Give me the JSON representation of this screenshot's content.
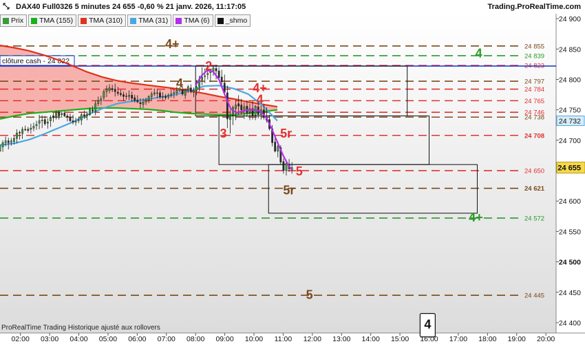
{
  "header": {
    "instrument": "DAX40 Full0326 5 minutes 24 655 -0,60 % 21 janv. 2026, 11:17:05",
    "site": "Trading.ProRealTime.com"
  },
  "legend": [
    {
      "label": "Prix",
      "color": "#3a9b3a"
    },
    {
      "label": "TMA (155)",
      "color": "#1ab21a"
    },
    {
      "label": "TMA (310)",
      "color": "#e0321a"
    },
    {
      "label": "TMA (31)",
      "color": "#4aa8e0"
    },
    {
      "label": "TMA (6)",
      "color": "#b030e8"
    },
    {
      "label": "_shmo",
      "color": "#111111"
    }
  ],
  "footer_note": "ProRealTime Trading  Historique ajusté aux rollovers",
  "chart_data": {
    "type": "candlestick",
    "x_ticks": [
      "02:00",
      "03:00",
      "04:00",
      "05:00",
      "06:00",
      "07:00",
      "08:00",
      "09:00",
      "10:00",
      "11:00",
      "12:00",
      "13:00",
      "14:00",
      "15:00",
      "16:00",
      "17:00",
      "18:00",
      "19:00",
      "20:00"
    ],
    "y_ticks": [
      24400,
      24450,
      24500,
      24550,
      24600,
      24650,
      24700,
      24750,
      24800,
      24850,
      24900
    ],
    "y_bold_tick": 24500,
    "ylim": [
      24383,
      24908
    ],
    "current_price": {
      "value": 24655,
      "label": "24 655"
    },
    "ma_31_value": {
      "value": 24732,
      "label": "24 732"
    },
    "cash_close": {
      "label": "clôture cash - 24 822",
      "value": 24822,
      "color": "#1030c8"
    },
    "levels": [
      {
        "value": 24855,
        "label": "24 855",
        "color": "#7a4a1a",
        "bold": false
      },
      {
        "value": 24839,
        "label": "24 839",
        "color": "#2a9a2a",
        "bold": false
      },
      {
        "value": 24823,
        "label": "24 823",
        "color": "#e23030",
        "bold": false
      },
      {
        "value": 24797,
        "label": "24 797",
        "color": "#7a4a1a",
        "bold": false
      },
      {
        "value": 24784,
        "label": "24 784",
        "color": "#e23030",
        "bold": false
      },
      {
        "value": 24765,
        "label": "24 765",
        "color": "#e23030",
        "bold": false
      },
      {
        "value": 24746,
        "label": "24 746",
        "color": "#e23030",
        "bold": false
      },
      {
        "value": 24738,
        "label": "24 738",
        "color": "#7a4a1a",
        "bold": false
      },
      {
        "value": 24708,
        "label": "24 708",
        "color": "#e23030",
        "bold": true
      },
      {
        "value": 24650,
        "label": "24 650",
        "color": "#e23030",
        "bold": false
      },
      {
        "value": 24621,
        "label": "24 621",
        "color": "#7a4a1a",
        "bold": true
      },
      {
        "value": 24572,
        "label": "24 572",
        "color": "#2a9a2a",
        "bold": false
      },
      {
        "value": 24445,
        "label": "24 445",
        "color": "#7a4a1a",
        "bold": false
      }
    ],
    "annotations": [
      {
        "text": "4+",
        "t": 7.2,
        "v": 24858,
        "color": "#7a4a1a"
      },
      {
        "text": "4",
        "t": 17.7,
        "v": 24843,
        "color": "#2a9a2a"
      },
      {
        "text": "2",
        "t": 8.45,
        "v": 24822,
        "color": "#e23030"
      },
      {
        "text": "4",
        "t": 7.45,
        "v": 24794,
        "color": "#7a4a1a"
      },
      {
        "text": "4+",
        "t": 10.2,
        "v": 24786,
        "color": "#e23030"
      },
      {
        "text": "4",
        "t": 10.2,
        "v": 24767,
        "color": "#e23030"
      },
      {
        "text": "3",
        "t": 8.95,
        "v": 24711,
        "color": "#e23030"
      },
      {
        "text": "5r",
        "t": 11.1,
        "v": 24711,
        "color": "#e23030"
      },
      {
        "text": "5",
        "t": 11.55,
        "v": 24649,
        "color": "#e23030"
      },
      {
        "text": "5r",
        "t": 11.2,
        "v": 24618,
        "color": "#7a4a1a"
      },
      {
        "text": "4+",
        "t": 17.6,
        "v": 24573,
        "color": "#2a9a2a"
      },
      {
        "text": "5",
        "t": 11.9,
        "v": 24446,
        "color": "#7a4a1a"
      },
      {
        "text": "4",
        "t": 15.95,
        "v": 24397,
        "color": "#111111",
        "boxed": true
      }
    ],
    "boxes": [
      {
        "t0": 8.0,
        "t1": 15.25,
        "v0": 24822,
        "v1": 24740
      },
      {
        "t0": 8.8,
        "t1": 16.0,
        "v0": 24740,
        "v1": 24660
      },
      {
        "t0": 10.5,
        "t1": 17.65,
        "v0": 24660,
        "v1": 24580
      }
    ],
    "time_range": [
      1.3,
      20.35
    ],
    "candles_ohlc": [
      [
        24682,
        24693,
        24681,
        24690
      ],
      [
        24689,
        24700,
        24681,
        24696
      ],
      [
        24696,
        24706,
        24690,
        24699
      ],
      [
        24699,
        24704,
        24685,
        24696
      ],
      [
        24697,
        24704,
        24691,
        24699
      ],
      [
        24698,
        24707,
        24693,
        24703
      ],
      [
        24703,
        24718,
        24695,
        24712
      ],
      [
        24713,
        24716,
        24701,
        24712
      ],
      [
        24711,
        24722,
        24702,
        24718
      ],
      [
        24718,
        24724,
        24715,
        24717
      ],
      [
        24718,
        24722,
        24712,
        24716
      ],
      [
        24718,
        24727,
        24711,
        24720
      ],
      [
        24720,
        24729,
        24715,
        24723
      ],
      [
        24724,
        24732,
        24717,
        24726
      ],
      [
        24728,
        24742,
        24718,
        24732
      ],
      [
        24733,
        24741,
        24720,
        24733
      ],
      [
        24734,
        24740,
        24724,
        24727
      ],
      [
        24728,
        24736,
        24719,
        24730
      ],
      [
        24732,
        24741,
        24722,
        24738
      ],
      [
        24740,
        24745,
        24730,
        24737
      ],
      [
        24738,
        24749,
        24734,
        24746
      ],
      [
        24746,
        24749,
        24734,
        24740
      ],
      [
        24742,
        24747,
        24737,
        24744
      ],
      [
        24745,
        24748,
        24738,
        24740
      ],
      [
        24740,
        24744,
        24731,
        24739
      ],
      [
        24738,
        24744,
        24730,
        24732
      ],
      [
        24732,
        24742,
        24726,
        24730
      ],
      [
        24730,
        24737,
        24724,
        24731
      ],
      [
        24732,
        24738,
        24728,
        24734
      ],
      [
        24733,
        24746,
        24725,
        24742
      ],
      [
        24742,
        24749,
        24735,
        24740
      ],
      [
        24740,
        24747,
        24733,
        24743
      ],
      [
        24742,
        24754,
        24740,
        24750
      ],
      [
        24750,
        24756,
        24745,
        24748
      ],
      [
        24748,
        24765,
        24741,
        24760
      ],
      [
        24760,
        24772,
        24756,
        24765
      ],
      [
        24765,
        24773,
        24758,
        24768
      ],
      [
        24770,
        24784,
        24764,
        24780
      ],
      [
        24780,
        24790,
        24771,
        24784
      ],
      [
        24782,
        24792,
        24777,
        24786
      ],
      [
        24785,
        24791,
        24779,
        24783
      ],
      [
        24784,
        24793,
        24772,
        24780
      ],
      [
        24779,
        24788,
        24773,
        24777
      ],
      [
        24777,
        24783,
        24772,
        24775
      ],
      [
        24775,
        24780,
        24765,
        24772
      ],
      [
        24772,
        24778,
        24767,
        24773
      ],
      [
        24772,
        24782,
        24766,
        24774
      ],
      [
        24774,
        24780,
        24763,
        24769
      ],
      [
        24770,
        24775,
        24762,
        24765
      ],
      [
        24766,
        24774,
        24761,
        24763
      ],
      [
        24762,
        24769,
        24752,
        24760
      ],
      [
        24759,
        24769,
        24753,
        24763
      ],
      [
        24763,
        24770,
        24758,
        24766
      ],
      [
        24766,
        24774,
        24761,
        24772
      ],
      [
        24772,
        24780,
        24766,
        24776
      ],
      [
        24776,
        24785,
        24773,
        24778
      ],
      [
        24778,
        24784,
        24769,
        24778
      ],
      [
        24778,
        24782,
        24768,
        24771
      ],
      [
        24772,
        24779,
        24766,
        24772
      ],
      [
        24772,
        24776,
        24766,
        24770
      ],
      [
        24771,
        24777,
        24767,
        24774
      ],
      [
        24774,
        24782,
        24770,
        24776
      ],
      [
        24777,
        24784,
        24769,
        24778
      ],
      [
        24778,
        24788,
        24773,
        24782
      ],
      [
        24782,
        24787,
        24779,
        24785
      ],
      [
        24783,
        24789,
        24773,
        24776
      ],
      [
        24774,
        24784,
        24768,
        24782
      ],
      [
        24783,
        24791,
        24778,
        24788
      ],
      [
        24786,
        24792,
        24777,
        24780
      ],
      [
        24779,
        24787,
        24771,
        24782
      ],
      [
        24782,
        24799,
        24774,
        24788
      ],
      [
        24788,
        24806,
        24780,
        24800
      ],
      [
        24799,
        24820,
        24790,
        24804
      ],
      [
        24806,
        24818,
        24794,
        24806
      ],
      [
        24808,
        24824,
        24800,
        24810
      ],
      [
        24811,
        24817,
        24796,
        24814
      ],
      [
        24812,
        24822,
        24806,
        24819
      ],
      [
        24818,
        24824,
        24800,
        24814
      ],
      [
        24814,
        24820,
        24799,
        24803
      ],
      [
        24804,
        24816,
        24786,
        24796
      ],
      [
        24794,
        24808,
        24774,
        24779
      ],
      [
        24778,
        24790,
        24720,
        24735
      ],
      [
        24734,
        24750,
        24711,
        24740
      ],
      [
        24741,
        24757,
        24725,
        24754
      ],
      [
        24752,
        24766,
        24733,
        24758
      ],
      [
        24760,
        24774,
        24742,
        24756
      ],
      [
        24758,
        24768,
        24742,
        24750
      ],
      [
        24748,
        24762,
        24735,
        24755
      ],
      [
        24756,
        24766,
        24738,
        24745
      ],
      [
        24746,
        24760,
        24733,
        24752
      ],
      [
        24752,
        24764,
        24734,
        24740
      ],
      [
        24741,
        24758,
        24733,
        24756
      ],
      [
        24755,
        24764,
        24736,
        24742
      ],
      [
        24742,
        24757,
        24734,
        24750
      ],
      [
        24750,
        24759,
        24734,
        24738
      ],
      [
        24737,
        24754,
        24729,
        24733
      ],
      [
        24734,
        24742,
        24716,
        24719
      ],
      [
        24719,
        24725,
        24690,
        24696
      ],
      [
        24697,
        24708,
        24680,
        24682
      ],
      [
        24682,
        24698,
        24672,
        24690
      ],
      [
        24688,
        24692,
        24660,
        24664
      ],
      [
        24665,
        24670,
        24645,
        24650
      ],
      [
        24650,
        24666,
        24642,
        24662
      ],
      [
        24661,
        24669,
        24648,
        24653
      ],
      [
        24652,
        24664,
        24645,
        24655
      ]
    ],
    "tma_155": [
      [
        1.3,
        24735
      ],
      [
        1.8,
        24740
      ],
      [
        2.3,
        24744
      ],
      [
        2.8,
        24746
      ],
      [
        3.3,
        24748
      ],
      [
        3.8,
        24750
      ],
      [
        4.3,
        24752
      ],
      [
        4.8,
        24753
      ],
      [
        5.3,
        24753
      ],
      [
        5.8,
        24752
      ],
      [
        6.3,
        24751
      ],
      [
        6.8,
        24749
      ],
      [
        7.3,
        24746
      ],
      [
        7.8,
        24744
      ],
      [
        8.3,
        24743
      ],
      [
        8.8,
        24742
      ],
      [
        9.3,
        24742
      ],
      [
        9.8,
        24744
      ],
      [
        10.3,
        24747
      ],
      [
        10.8,
        24750
      ]
    ],
    "tma_310": [
      [
        1.3,
        24856
      ],
      [
        1.8,
        24852
      ],
      [
        2.3,
        24847
      ],
      [
        2.8,
        24840
      ],
      [
        3.3,
        24832
      ],
      [
        3.8,
        24822
      ],
      [
        4.3,
        24812
      ],
      [
        4.8,
        24804
      ],
      [
        5.3,
        24798
      ],
      [
        5.8,
        24794
      ],
      [
        6.3,
        24791
      ],
      [
        6.8,
        24788
      ],
      [
        7.3,
        24785
      ],
      [
        7.8,
        24781
      ],
      [
        8.3,
        24777
      ],
      [
        8.8,
        24772
      ],
      [
        9.3,
        24768
      ],
      [
        9.8,
        24763
      ],
      [
        10.3,
        24759
      ],
      [
        10.8,
        24755
      ]
    ],
    "tma_31": [
      [
        1.3,
        24692
      ],
      [
        1.8,
        24695
      ],
      [
        2.3,
        24701
      ],
      [
        2.8,
        24710
      ],
      [
        3.3,
        24720
      ],
      [
        3.8,
        24730
      ],
      [
        4.3,
        24742
      ],
      [
        4.8,
        24752
      ],
      [
        5.3,
        24760
      ],
      [
        5.8,
        24764
      ],
      [
        6.3,
        24767
      ],
      [
        6.8,
        24771
      ],
      [
        7.3,
        24775
      ],
      [
        7.8,
        24781
      ],
      [
        8.3,
        24789
      ],
      [
        8.8,
        24790
      ],
      [
        9.3,
        24785
      ],
      [
        9.8,
        24776
      ],
      [
        10.3,
        24757
      ],
      [
        10.8,
        24732
      ]
    ],
    "tma_6": [
      [
        8.0,
        24790
      ],
      [
        8.2,
        24806
      ],
      [
        8.4,
        24815
      ],
      [
        8.6,
        24813
      ],
      [
        8.8,
        24800
      ],
      [
        9.0,
        24775
      ],
      [
        9.2,
        24752
      ],
      [
        9.4,
        24745
      ],
      [
        9.6,
        24748
      ],
      [
        9.8,
        24750
      ],
      [
        10.0,
        24750
      ],
      [
        10.2,
        24748
      ],
      [
        10.4,
        24739
      ],
      [
        10.6,
        24720
      ],
      [
        10.8,
        24697
      ],
      [
        11.0,
        24675
      ],
      [
        11.2,
        24657
      ],
      [
        11.3,
        24652
      ]
    ]
  }
}
